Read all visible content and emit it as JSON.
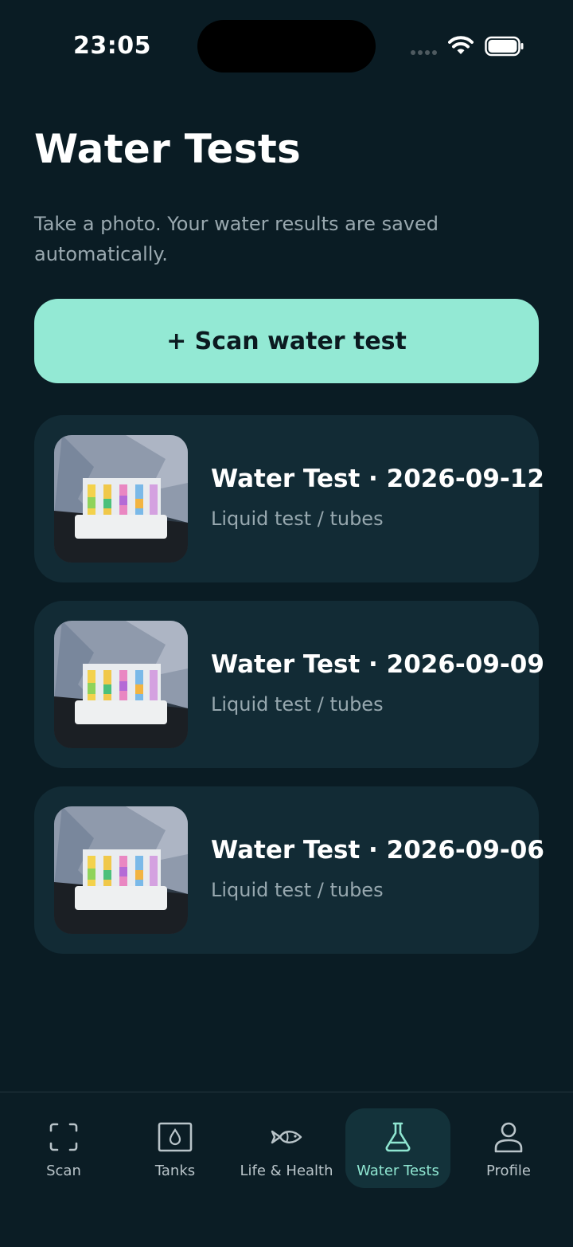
{
  "status_bar": {
    "time": "23:05"
  },
  "header": {
    "title": "Water Tests",
    "subtitle": "Take a photo. Your water results are saved automatically."
  },
  "scan_button": {
    "label": "+ Scan water test"
  },
  "tests": [
    {
      "title": "Water Test · 2026-09-12",
      "type": "Liquid test / tubes"
    },
    {
      "title": "Water Test · 2026-09-09",
      "type": "Liquid test / tubes"
    },
    {
      "title": "Water Test · 2026-09-06",
      "type": "Liquid test / tubes"
    }
  ],
  "tab_bar": {
    "active": "Water Tests",
    "tabs": [
      {
        "label": "Scan",
        "icon": "scan-frame-icon"
      },
      {
        "label": "Tanks",
        "icon": "tank-drop-icon"
      },
      {
        "label": "Life & Health",
        "icon": "fish-icon"
      },
      {
        "label": "Water Tests",
        "icon": "flask-icon"
      },
      {
        "label": "Profile",
        "icon": "person-icon"
      }
    ]
  },
  "colors": {
    "background": "#0a1c24",
    "card": "#122b35",
    "accent": "#93e9d4",
    "active_tab_label": "#8fe6d1"
  }
}
